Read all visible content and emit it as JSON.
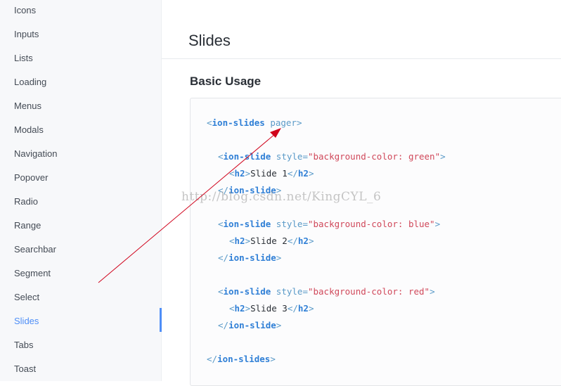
{
  "sidebar": {
    "items": [
      {
        "label": "Icons"
      },
      {
        "label": "Inputs"
      },
      {
        "label": "Lists"
      },
      {
        "label": "Loading"
      },
      {
        "label": "Menus"
      },
      {
        "label": "Modals"
      },
      {
        "label": "Navigation"
      },
      {
        "label": "Popover"
      },
      {
        "label": "Radio"
      },
      {
        "label": "Range"
      },
      {
        "label": "Searchbar"
      },
      {
        "label": "Segment"
      },
      {
        "label": "Select"
      },
      {
        "label": "Slides",
        "active": true
      },
      {
        "label": "Tabs"
      },
      {
        "label": "Toast"
      }
    ],
    "active_color": "#4e8ef7"
  },
  "main": {
    "page_title": "Slides",
    "section_title": "Basic Usage"
  },
  "code": {
    "open_tag": "ion-slides",
    "pager_attr": "pager",
    "slide_tag": "ion-slide",
    "style_attr": "style",
    "h2_tag": "h2",
    "slides": [
      {
        "style_value": "\"background-color: green\"",
        "heading": "Slide 1"
      },
      {
        "style_value": "\"background-color: blue\"",
        "heading": "Slide 2"
      },
      {
        "style_value": "\"background-color: red\"",
        "heading": "Slide 3"
      }
    ]
  },
  "watermark": "http://blog.csdn.net/KingCYL_6",
  "colors": {
    "tag": "#2f7fd6",
    "string": "#d0485a",
    "annotation_arrow": "#d0021b"
  }
}
